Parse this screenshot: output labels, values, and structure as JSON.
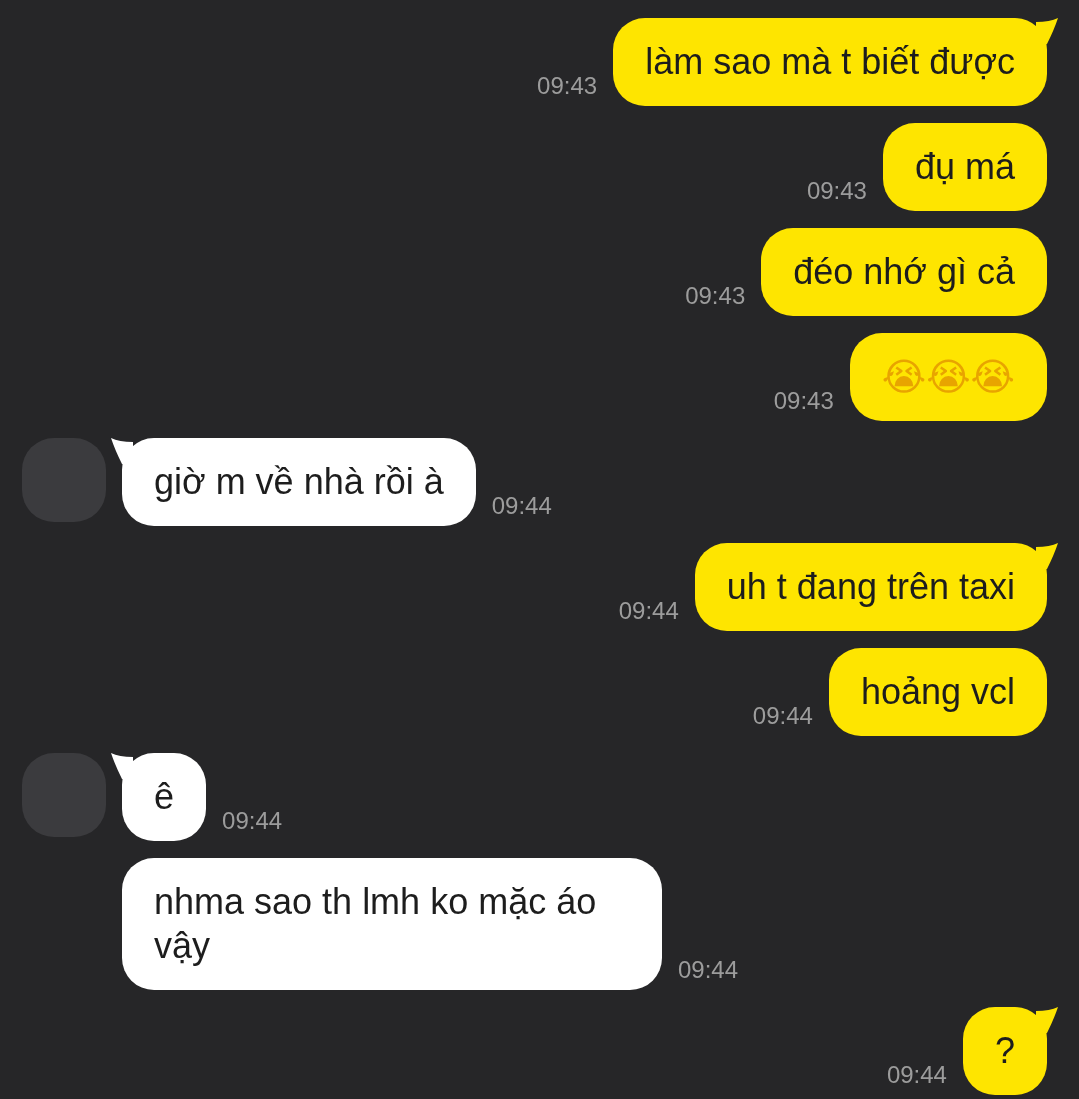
{
  "messages": [
    {
      "kind": "outgoing",
      "text": "làm sao mà t biết được",
      "time": "09:43",
      "tail": true
    },
    {
      "kind": "outgoing",
      "text": "đụ má",
      "time": "09:43",
      "tail": false
    },
    {
      "kind": "outgoing",
      "text": "đéo nhớ gì cả",
      "time": "09:43",
      "tail": false
    },
    {
      "kind": "outgoing",
      "text": "😭😭😭",
      "time": "09:43",
      "tail": false
    },
    {
      "kind": "incoming",
      "text": "giờ m về nhà rồi à",
      "time": "09:44",
      "tail": true,
      "avatar": true
    },
    {
      "kind": "outgoing",
      "text": "uh t đang trên taxi",
      "time": "09:44",
      "tail": true
    },
    {
      "kind": "outgoing",
      "text": "hoảng vcl",
      "time": "09:44",
      "tail": false
    },
    {
      "kind": "incoming",
      "text": "ê",
      "time": "09:44",
      "tail": true,
      "avatar": true
    },
    {
      "kind": "incoming",
      "text": "nhma sao th lmh ko mặc áo vậy",
      "time": "09:44",
      "tail": false,
      "avatar": false
    },
    {
      "kind": "outgoing",
      "text": "?",
      "time": "09:44",
      "tail": true
    }
  ]
}
